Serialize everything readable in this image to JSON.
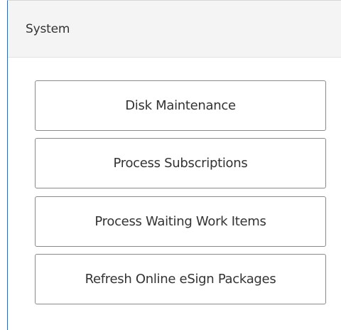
{
  "panel": {
    "title": "System"
  },
  "buttons": [
    {
      "label": "Disk Maintenance"
    },
    {
      "label": "Process Subscriptions"
    },
    {
      "label": "Process Waiting Work Items"
    },
    {
      "label": "Refresh Online eSign Packages"
    }
  ]
}
